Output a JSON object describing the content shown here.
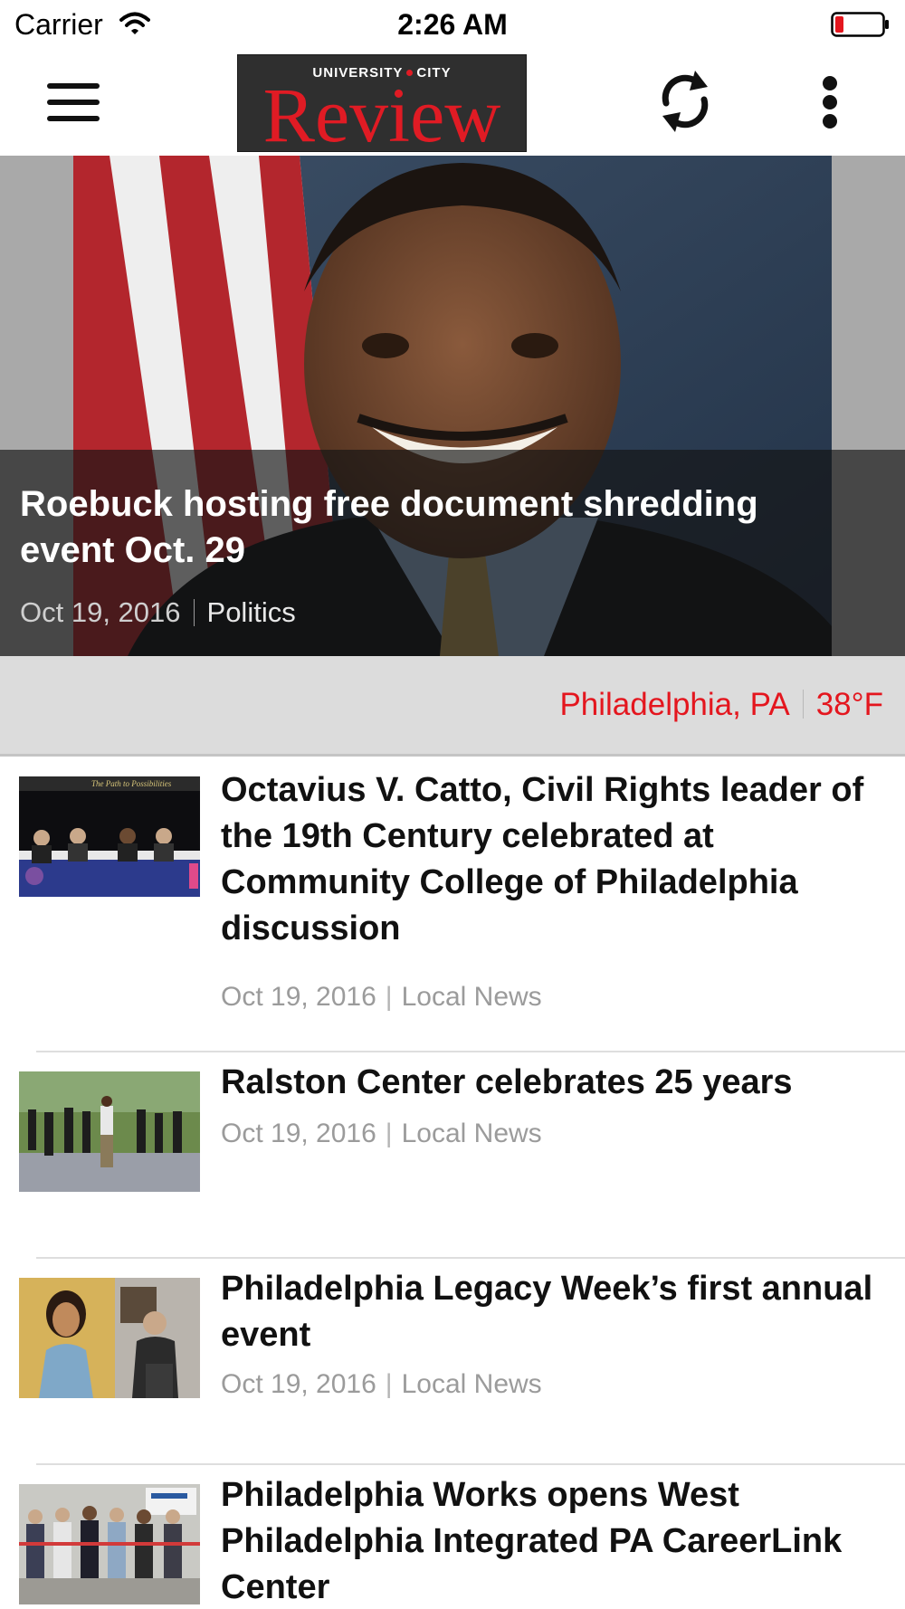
{
  "status_bar": {
    "carrier": "Carrier",
    "time": "2:26 AM",
    "icons": [
      "wifi-icon",
      "battery-low-icon"
    ]
  },
  "nav": {
    "logo_top": "UNIVERSITY",
    "logo_top_right": "CITY",
    "logo_main": "Review",
    "icons": [
      "menu-icon",
      "refresh-icon",
      "more-vertical-icon"
    ],
    "brand_color": "#e01b24"
  },
  "hero": {
    "title": "Roebuck hosting free document shredding event Oct. 29",
    "date": "Oct 19, 2016",
    "category": "Politics"
  },
  "weather": {
    "location": "Philadelphia, PA",
    "temperature": "38°F",
    "color": "#e4161e"
  },
  "articles": [
    {
      "title": "Octavius V. Catto, Civil Rights leader of the 19th Century celebrated at Community College of Philadelphia discussion",
      "date": "Oct 19, 2016",
      "category": "Local News",
      "banner_text": "The Path to Possibilities"
    },
    {
      "title": "Ralston Center celebrates 25 years",
      "date": "Oct 19, 2016",
      "category": "Local News"
    },
    {
      "title": "Philadelphia Legacy Week’s first annual event",
      "date": "Oct 19, 2016",
      "category": "Local News"
    },
    {
      "title": "Philadelphia Works opens West Philadelphia Integrated PA CareerLink Center",
      "date": "",
      "category": ""
    }
  ],
  "separator": "|"
}
